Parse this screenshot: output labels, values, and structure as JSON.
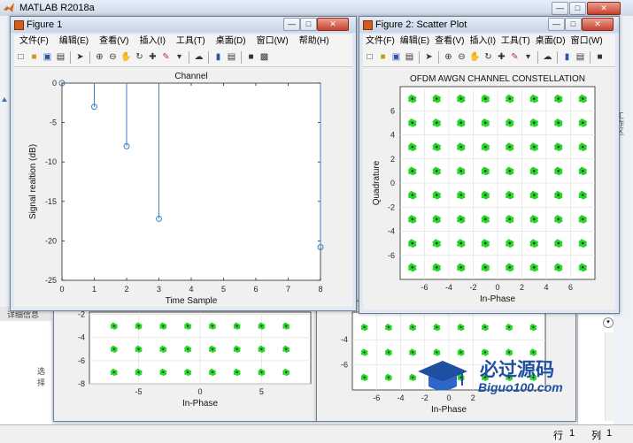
{
  "main_window": {
    "title": "MATLAB R2018a"
  },
  "figure_menu": [
    "文件(F)",
    "编辑(E)",
    "查看(V)",
    "插入(I)",
    "工具(T)",
    "桌面(D)",
    "窗口(W)",
    "帮助(H)"
  ],
  "toolbar_icons": [
    "new-file-icon",
    "open-folder-icon",
    "save-icon",
    "print-icon",
    "select-arrow-icon",
    "zoom-in-icon",
    "zoom-out-icon",
    "pan-hand-icon",
    "rotate-icon",
    "data-cursor-icon",
    "brush-icon",
    "link-plot-icon",
    "colorbar-icon",
    "legend-icon",
    "hide-plot-tools-icon",
    "show-plot-tools-icon"
  ],
  "figure1": {
    "title": "Figure 1",
    "chart_data": {
      "type": "stem",
      "title": "Channel",
      "xlabel": "Time Sample",
      "ylabel": "Signal realtion (dB)",
      "x": [
        0,
        1,
        2,
        3,
        8
      ],
      "y": [
        0,
        -3,
        -8,
        -17.2,
        -20.8
      ],
      "xlim": [
        0,
        8
      ],
      "ylim": [
        -25,
        0
      ],
      "xticks": [
        0,
        1,
        2,
        3,
        4,
        5,
        6,
        7,
        8
      ],
      "yticks": [
        0,
        -5,
        -10,
        -15,
        -20,
        -25
      ],
      "color": "#3d7fbf"
    }
  },
  "figure2": {
    "title": "Figure 2: Scatter Plot",
    "chart_data": {
      "type": "scatter",
      "title": "OFDM AWGN CHANNEL CONSTELLATION",
      "xlabel": "In-Phase",
      "ylabel": "Quadrature",
      "points_x": [
        -7,
        -5,
        -3,
        -1,
        1,
        3,
        5,
        7
      ],
      "points_y": [
        -7,
        -5,
        -3,
        -1,
        1,
        3,
        5,
        7
      ],
      "xlim": [
        -8,
        8
      ],
      "ylim": [
        -8,
        8
      ],
      "xticks": [
        -6,
        -4,
        -2,
        0,
        2,
        4,
        6
      ],
      "yticks": [
        6,
        4,
        2,
        0,
        -2,
        -4,
        -6
      ],
      "cluster_color": "#27d527",
      "center_color": "#1a1a1a",
      "grid": true
    }
  },
  "back_figure_left": {
    "chart_data": {
      "type": "scatter",
      "xlabel": "In-Phase",
      "xticks": [
        -5,
        0,
        5
      ],
      "yticks": [
        -2,
        -4,
        -6,
        -8
      ],
      "points_x": [
        -7,
        -5,
        -3,
        -1,
        1,
        3,
        5,
        7
      ],
      "points_y": [
        -3,
        -5,
        -7
      ]
    }
  },
  "back_figure_right": {
    "chart_data": {
      "type": "scatter",
      "xlabel": "In-Phase",
      "xticks": [
        -6,
        -4,
        -2,
        0,
        2
      ],
      "yticks": [
        -4,
        -6
      ],
      "points_x": [
        -7,
        -5,
        -3,
        -1,
        1,
        3,
        5,
        7
      ],
      "points_y": [
        -3,
        -5,
        -7
      ]
    }
  },
  "side_panel": {
    "label_details": "详细信息",
    "label_select": "选择"
  },
  "status": {
    "row_label": "行",
    "row_value": "1",
    "col_label": "列",
    "col_value": "1"
  },
  "watermark": {
    "brand": "必过源码",
    "url": "Biguo100.com"
  }
}
